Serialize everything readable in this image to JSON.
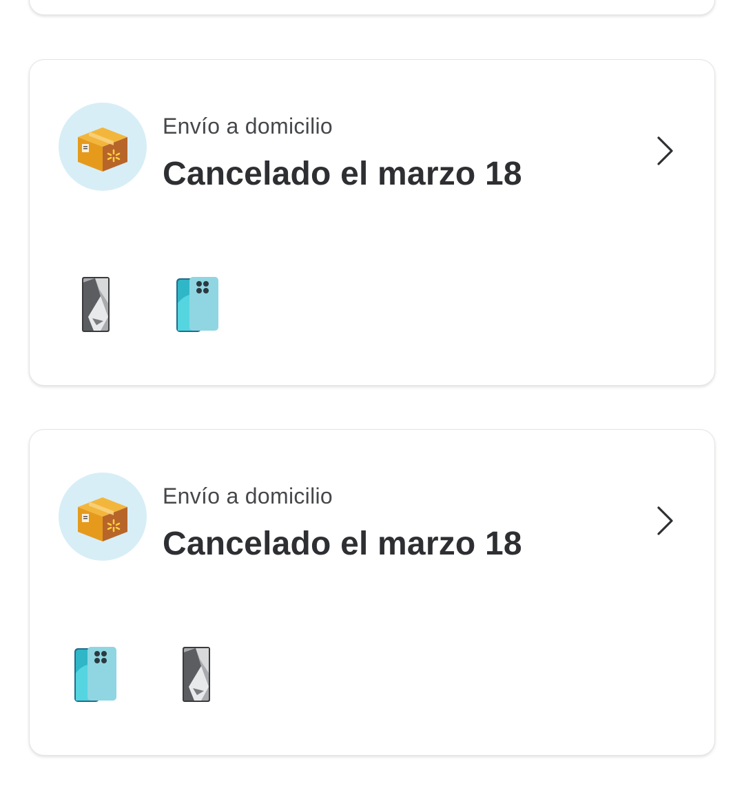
{
  "orders": [
    {
      "delivery_type": "Envío a domicilio",
      "status": "Cancelado el marzo 18",
      "items": [
        {
          "icon": "phone-dark-icon"
        },
        {
          "icon": "phone-blue-icon"
        }
      ]
    },
    {
      "delivery_type": "Envío a domicilio",
      "status": "Cancelado el marzo 18",
      "items": [
        {
          "icon": "phone-blue-icon"
        },
        {
          "icon": "phone-dark-icon"
        }
      ]
    }
  ],
  "colors": {
    "icon_bg": "#d7eef6",
    "box_orange": "#e6a12a",
    "box_brown": "#b8762c",
    "text_primary": "#2e2f32",
    "text_secondary": "#46474a",
    "card_border": "#e3e4e5"
  }
}
